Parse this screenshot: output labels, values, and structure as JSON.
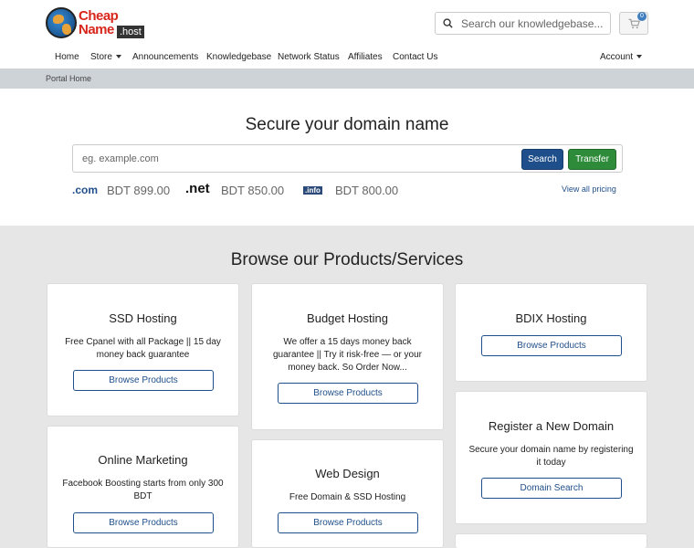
{
  "header": {
    "logo_line1": "Cheap",
    "logo_line2": "Name",
    "logo_suffix": ".host",
    "search_placeholder": "Search our knowledgebase...",
    "cart_count": "0"
  },
  "nav": {
    "items": [
      {
        "label": "Home"
      },
      {
        "label": "Store"
      },
      {
        "label": "Announcements"
      },
      {
        "label": "Knowledgebase"
      },
      {
        "label": "Network Status"
      },
      {
        "label": "Affiliates"
      },
      {
        "label": "Contact Us"
      }
    ],
    "account_label": "Account"
  },
  "breadcrumb": {
    "current": "Portal Home"
  },
  "domain": {
    "title": "Secure your domain name",
    "placeholder": "eg. example.com",
    "search_label": "Search",
    "transfer_label": "Transfer",
    "tlds": [
      {
        "name": ".com",
        "price": "BDT 899.00"
      },
      {
        "name": ".net",
        "price": "BDT 850.00"
      },
      {
        "name": ".info",
        "price": "BDT 800.00"
      }
    ],
    "view_all": "View all pricing"
  },
  "browse": {
    "title": "Browse our Products/Services",
    "cards": [
      {
        "title": "SSD Hosting",
        "desc": "Free Cpanel with all Package || 15 day money back guarantee",
        "button": "Browse Products"
      },
      {
        "title": "Budget Hosting",
        "desc": "We offer a 15 days money back guarantee || Try it risk-free — or your money back. So Order Now...",
        "button": "Browse Products"
      },
      {
        "title": "BDIX Hosting",
        "desc": "",
        "button": "Browse Products"
      },
      {
        "title": "Online Marketing",
        "desc": "Facebook Boosting starts from only 300 BDT",
        "button": "Browse Products"
      },
      {
        "title": "Web Design",
        "desc": "Free Domain & SSD Hosting",
        "button": "Browse Products"
      },
      {
        "title": "Register a New Domain",
        "desc": "Secure your domain name by registering it today",
        "button": "Domain Search"
      }
    ]
  },
  "colors": {
    "brand_red": "#d9261c",
    "primary_blue": "#1f4f8a",
    "transfer_green": "#2e8b3a",
    "breadcrumb_bg": "#ced3d8",
    "section_bg": "#e6e6e6"
  }
}
